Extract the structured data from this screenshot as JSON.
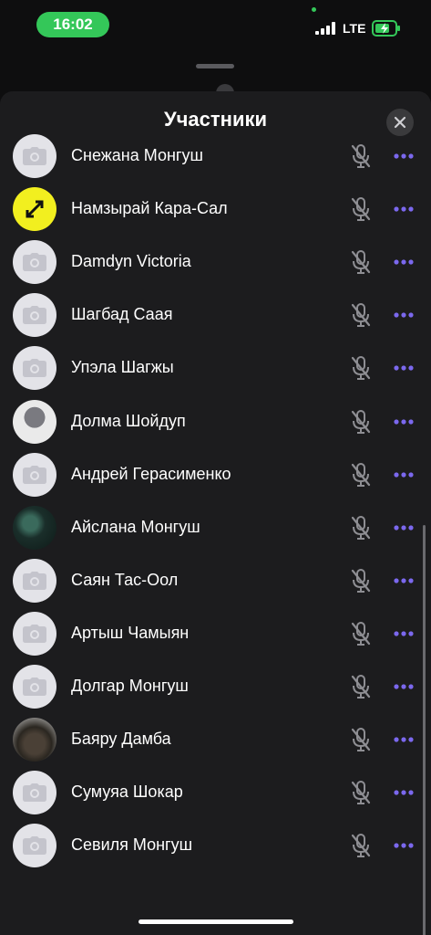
{
  "status_bar": {
    "time": "16:02",
    "network": "LTE"
  },
  "sheet": {
    "title": "Участники",
    "close_icon": "close-icon"
  },
  "participants": [
    {
      "name": "Снежана Монгуш",
      "avatar": "camera-icon",
      "mic": "muted"
    },
    {
      "name": "Намзырай Кара-Сал",
      "avatar": "photo",
      "mic": "muted"
    },
    {
      "name": "Damdyn Victoria",
      "avatar": "camera-icon",
      "mic": "muted"
    },
    {
      "name": "Шагбад Саая",
      "avatar": "camera-icon",
      "mic": "muted"
    },
    {
      "name": "Упэла Шагжы",
      "avatar": "camera-icon",
      "mic": "muted"
    },
    {
      "name": "Долма Шойдуп",
      "avatar": "photo",
      "mic": "muted"
    },
    {
      "name": "Андрей Герасименко",
      "avatar": "camera-icon",
      "mic": "muted"
    },
    {
      "name": "Айслана Монгуш",
      "avatar": "photo",
      "mic": "muted"
    },
    {
      "name": "Саян Тас-Оол",
      "avatar": "camera-icon",
      "mic": "muted"
    },
    {
      "name": "Артыш Чамыян",
      "avatar": "camera-icon",
      "mic": "muted"
    },
    {
      "name": "Долгар Монгуш",
      "avatar": "camera-icon",
      "mic": "muted"
    },
    {
      "name": "Баяру Дамба",
      "avatar": "photo",
      "mic": "muted"
    },
    {
      "name": "Сумуяа Шокар",
      "avatar": "camera-icon",
      "mic": "muted"
    },
    {
      "name": "Севиля Монгуш",
      "avatar": "camera-icon",
      "mic": "muted"
    }
  ],
  "colors": {
    "accent": "#7b68ee",
    "time_pill": "#34c759",
    "sheet_bg": "#1c1c1e"
  }
}
